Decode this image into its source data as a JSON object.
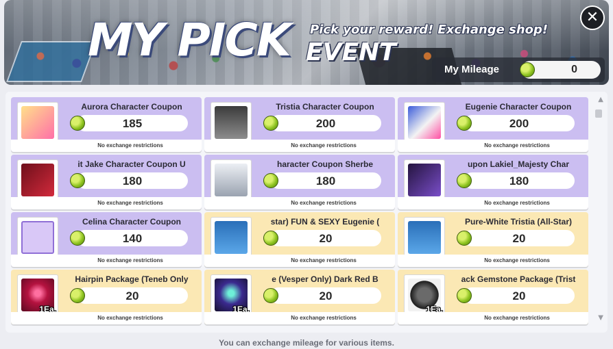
{
  "header": {
    "title": "MY PICK",
    "event_word": "EVENT",
    "subtitle": "Pick your reward! Exchange shop!",
    "close_icon": "close-icon"
  },
  "mileage": {
    "label": "My Mileage",
    "value": "0",
    "coin_icon": "mileage-coin-icon"
  },
  "items": [
    {
      "name": "Aurora Character Coupon",
      "price": "185",
      "restriction": "No exchange restrictions",
      "color": "purple",
      "art": "art-pink",
      "qty": ""
    },
    {
      "name": "Tristia Character Coupon",
      "price": "200",
      "restriction": "No exchange restrictions",
      "color": "purple",
      "art": "art-dark",
      "qty": ""
    },
    {
      "name": "Eugenie Character Coupon",
      "price": "200",
      "restriction": "No exchange restrictions",
      "color": "purple",
      "art": "art-blue",
      "qty": ""
    },
    {
      "name": "it Jake Character Coupon   U",
      "price": "180",
      "restriction": "No exchange restrictions",
      "color": "purple",
      "art": "art-red",
      "qty": ""
    },
    {
      "name": "haracter Coupon        Sherbe",
      "price": "180",
      "restriction": "No exchange restrictions",
      "color": "purple",
      "art": "art-white",
      "qty": ""
    },
    {
      "name": "upon        Lakiel_Majesty Char",
      "price": "180",
      "restriction": "No exchange restrictions",
      "color": "purple",
      "art": "art-violet",
      "qty": ""
    },
    {
      "name": "Celina Character Coupon",
      "price": "140",
      "restriction": "No exchange restrictions",
      "color": "purple",
      "art": "art-celina",
      "qty": ""
    },
    {
      "name": "star)     FUN & SEXY Eugenie (",
      "price": "20",
      "restriction": "No exchange restrictions",
      "color": "yellow",
      "art": "art-figure",
      "qty": ""
    },
    {
      "name": "Pure-White Tristia (All-Star)",
      "price": "20",
      "restriction": "No exchange restrictions",
      "color": "yellow",
      "art": "art-figure",
      "qty": ""
    },
    {
      "name": "Hairpin Package (Teneb Only",
      "price": "20",
      "restriction": "No exchange restrictions",
      "color": "yellow",
      "art": "art-crimson",
      "qty": "1Ea."
    },
    {
      "name": "e (Vesper Only)     Dark Red B",
      "price": "20",
      "restriction": "No exchange restrictions",
      "color": "yellow",
      "art": "art-vesper",
      "qty": "1Ea."
    },
    {
      "name": "ack Gemstone Package (Trist",
      "price": "20",
      "restriction": "No exchange restrictions",
      "color": "yellow",
      "art": "art-gem",
      "qty": "1Ea."
    }
  ],
  "footer": "You can exchange mileage for various items."
}
